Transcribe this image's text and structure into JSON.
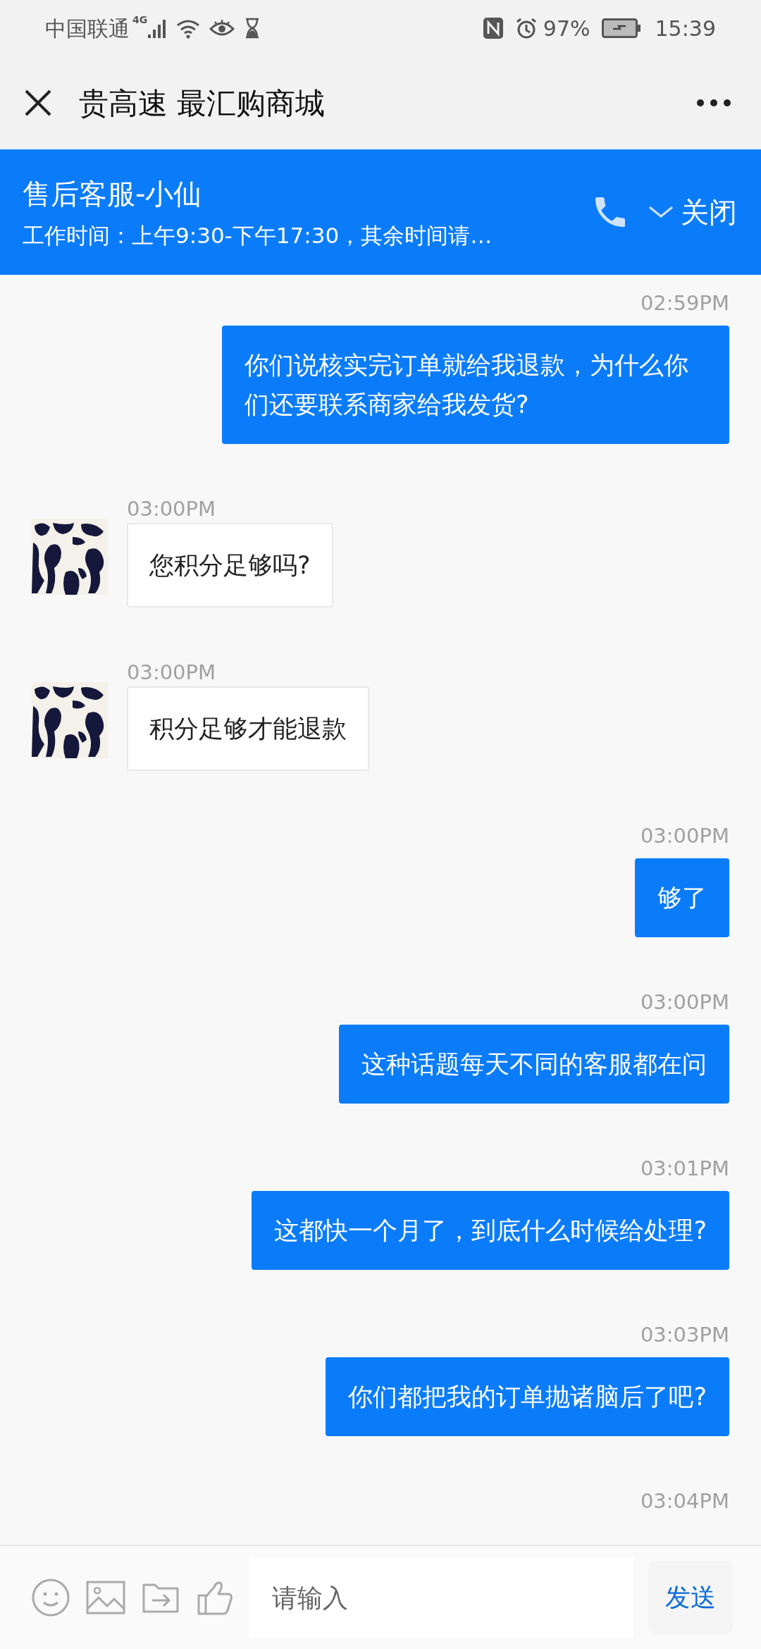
{
  "status_bar": {
    "carrier": "中国联通",
    "network": "4G",
    "battery": "97%",
    "time": "15:39"
  },
  "header": {
    "title": "贵高速 最汇购商城"
  },
  "agent_banner": {
    "name": "售后客服-小仙",
    "hours": "工作时间：上午9:30-下午17:30，其余时间请…",
    "close": "关闭"
  },
  "messages": [
    {
      "kind": "outgoing",
      "time": "02:59PM",
      "text": "你们说核实完订单就给我退款，为什么你们还要联系商家给我发货?"
    },
    {
      "kind": "incoming",
      "time": "03:00PM",
      "text": "您积分足够吗?"
    },
    {
      "kind": "incoming",
      "time": "03:00PM",
      "text": "积分足够才能退款"
    },
    {
      "kind": "outgoing",
      "time": "03:00PM",
      "text": "够了"
    },
    {
      "kind": "outgoing",
      "time": "03:00PM",
      "text": "这种话题每天不同的客服都在问"
    },
    {
      "kind": "outgoing",
      "time": "03:01PM",
      "text": "这都快一个月了，到底什么时候给处理?"
    },
    {
      "kind": "outgoing",
      "time": "03:03PM",
      "text": "你们都把我的订单抛诸脑后了吧?"
    },
    {
      "kind": "timestamp",
      "time": "03:04PM"
    }
  ],
  "composer": {
    "placeholder": "请输入",
    "send": "发送"
  }
}
